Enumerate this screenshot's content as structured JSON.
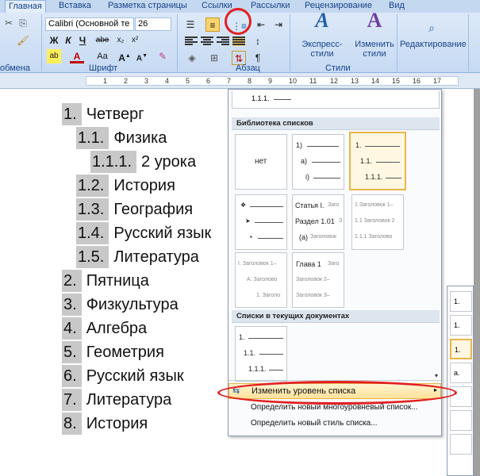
{
  "ribbon": {
    "tabs": [
      "Главная",
      "Вставка",
      "Разметка страницы",
      "Ссылки",
      "Рассылки",
      "Рецензирование",
      "Вид"
    ],
    "font_name": "Calibri (Основной те",
    "font_size": "26",
    "group_labels": {
      "clipboard": "обмена",
      "font": "Шрифт",
      "paragraph": "Абзац",
      "styles": "Стили"
    },
    "styles_buttons": {
      "express_line1": "Экспресс-стили",
      "change_line1": "Изменить",
      "change_line2": "стили"
    },
    "editing_label": "Редактирование",
    "font_buttons": [
      "Ж",
      "К",
      "Ч",
      "abe",
      "x₂",
      "x²",
      "Аа"
    ]
  },
  "ruler": {
    "numbers": [
      "1",
      "2",
      "3",
      "4",
      "5",
      "6",
      "7",
      "8",
      "9",
      "10",
      "11",
      "12",
      "13",
      "14",
      "15",
      "16",
      "17"
    ]
  },
  "document": {
    "items": [
      {
        "num": "1.",
        "text": "Четверг"
      },
      {
        "num": "1.1.",
        "text": "Физика"
      },
      {
        "num": "1.1.1.",
        "text": "2 урока"
      },
      {
        "num": "1.2.",
        "text": "История"
      },
      {
        "num": "1.3.",
        "text": "География"
      },
      {
        "num": "1.4.",
        "text": "Русский язык"
      },
      {
        "num": "1.5.",
        "text": "Литература"
      },
      {
        "num": "2.",
        "text": "Пятница"
      },
      {
        "num": "3.",
        "text": "Физкультура"
      },
      {
        "num": "4.",
        "text": "Алгебра"
      },
      {
        "num": "5.",
        "text": "Геометрия"
      },
      {
        "num": "6.",
        "text": "Русский язык"
      },
      {
        "num": "7.",
        "text": "Литература"
      },
      {
        "num": "8.",
        "text": "История"
      }
    ]
  },
  "dropdown": {
    "top_partial": "1.1.1.",
    "library_header": "Библиотека списков",
    "tile_none": "нет",
    "tile_paren": [
      "1)",
      "a)",
      "i)"
    ],
    "tile_num": [
      "1.",
      "1.1.",
      "1.1.1."
    ],
    "tile_article": [
      "Статья I.",
      "Заго",
      "Раздел 1.01",
      "З",
      "(a)",
      "Заголовок"
    ],
    "tile_heading": [
      "1 Заголовок 1–",
      "1.1 Заголовок 2",
      "1.1.1 Заголово"
    ],
    "tile_roman": [
      "I. Заголовок 1–",
      "A. Заголово",
      "1. Заголо"
    ],
    "tile_chapter": [
      "Глава 1",
      "Заго",
      "Заголовок 2–",
      "Заголовок 3–"
    ],
    "current_header": "Списки в текущих документах",
    "current_tile": [
      "1.",
      "1.1.",
      "1.1.1."
    ],
    "menu": {
      "change_level": "Изменить уровень списка",
      "define_multilevel": "Определить новый многоуровневый список...",
      "define_style": "Определить новый стиль списка..."
    }
  },
  "subpanel": {
    "labels": [
      "1.",
      "1.",
      "1.",
      "a."
    ]
  }
}
